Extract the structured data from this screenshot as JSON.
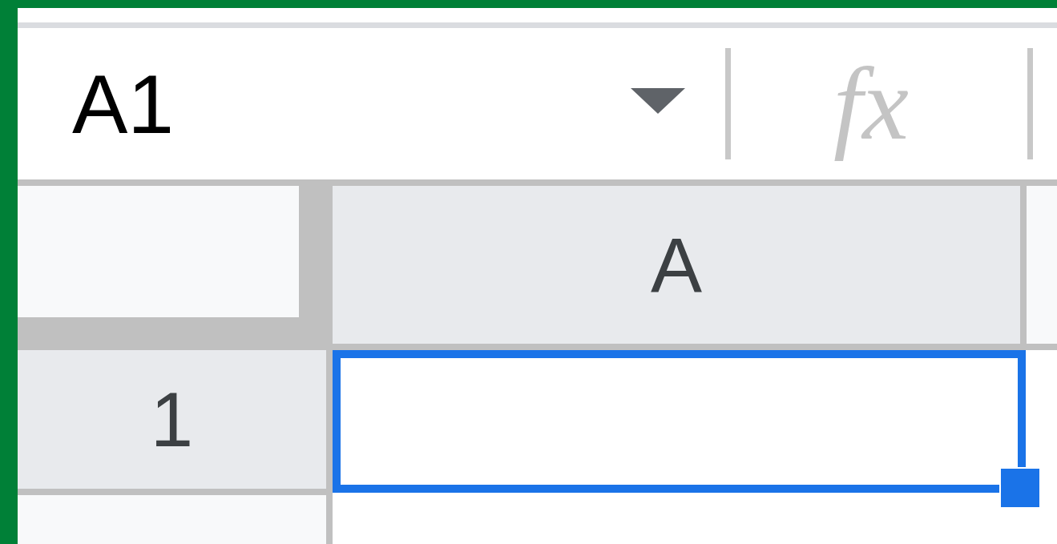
{
  "name_box": {
    "value": "A1"
  },
  "formula_bar": {
    "icon_text": "fx"
  },
  "columns": [
    {
      "label": "A"
    }
  ],
  "rows": [
    {
      "label": "1",
      "cells": [
        {
          "selected": true
        }
      ]
    }
  ]
}
